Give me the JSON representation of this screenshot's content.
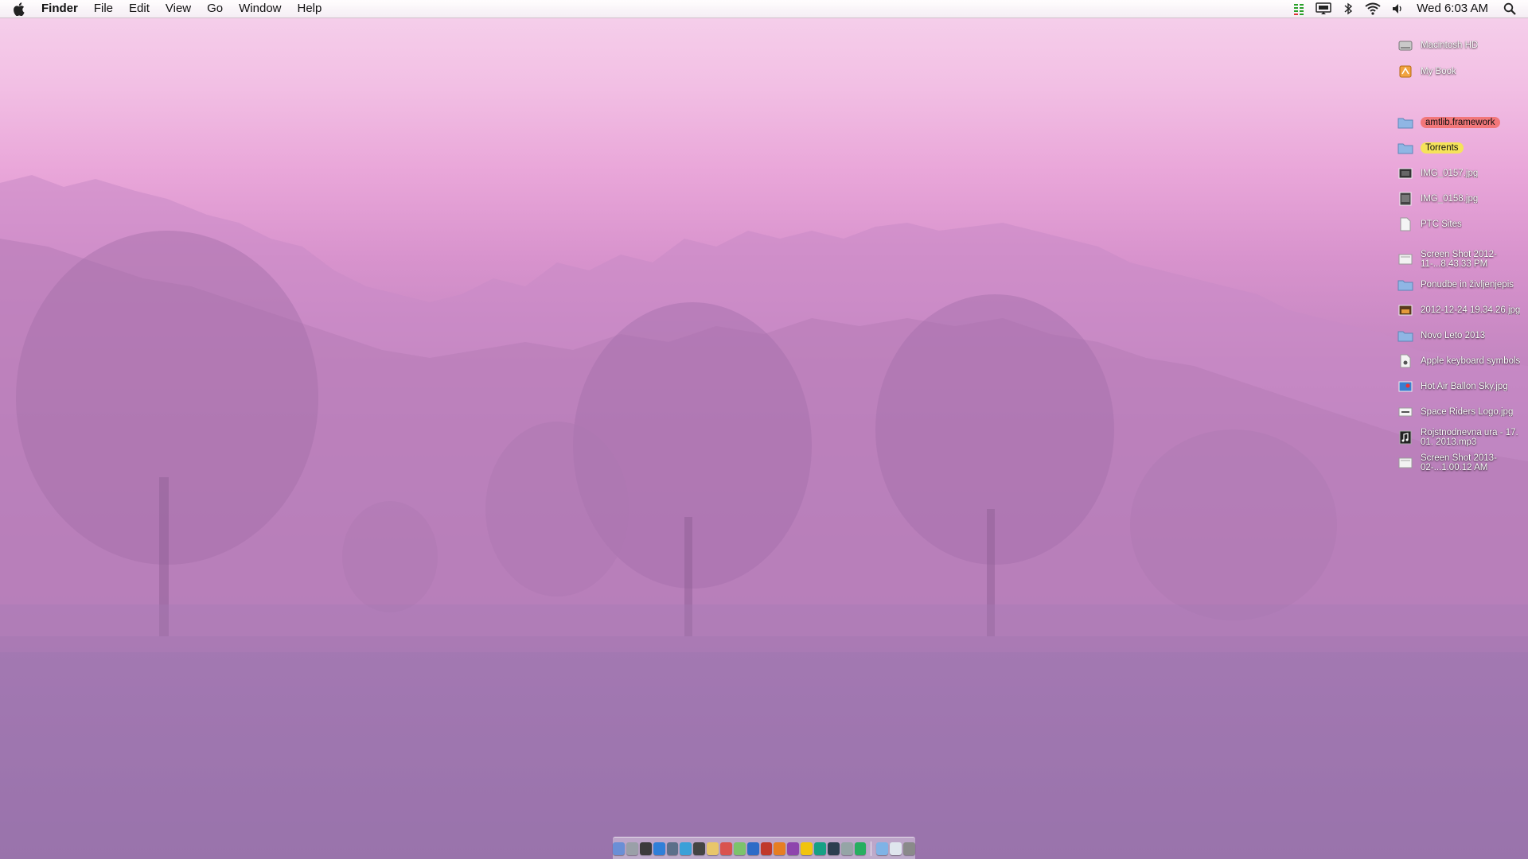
{
  "menubar": {
    "app_name": "Finder",
    "menus": [
      "File",
      "Edit",
      "View",
      "Go",
      "Window",
      "Help"
    ],
    "clock": "Wed 6:03 AM",
    "status_icons": [
      "activity-meter-icon",
      "airplay-display-icon",
      "bluetooth-icon",
      "wifi-icon",
      "volume-icon",
      "spotlight-icon"
    ]
  },
  "desktop_items": [
    {
      "label": "Macintosh HD",
      "icon": "hard-drive-icon"
    },
    {
      "label": "My Book",
      "icon": "external-drive-icon"
    },
    {
      "label": "amtlib.framework",
      "icon": "folder-icon",
      "tag_color": "#f2777a"
    },
    {
      "label": "Torrents",
      "icon": "folder-icon",
      "tag_color": "#f5e35a"
    },
    {
      "label": "IMG_0157.jpg",
      "icon": "image-thumbnail-icon"
    },
    {
      "label": "IMG_0158.jpg",
      "icon": "image-thumbnail-icon"
    },
    {
      "label": "PTC Sites",
      "icon": "document-icon"
    },
    {
      "label": "Screen Shot 2012-11-...8.43.33 PM",
      "icon": "screenshot-icon"
    },
    {
      "label": "Ponudbe in življenjepis",
      "icon": "folder-icon"
    },
    {
      "label": "2012-12-24 19.34.26.jpg",
      "icon": "image-thumbnail-icon"
    },
    {
      "label": "Novo Leto 2013",
      "icon": "folder-icon"
    },
    {
      "label": "Apple keyboard symbols",
      "icon": "document-icon"
    },
    {
      "label": "Hot Air Ballon Sky.jpg",
      "icon": "image-thumbnail-icon"
    },
    {
      "label": "Space Riders Logo.jpg",
      "icon": "image-thumbnail-icon"
    },
    {
      "label": "Rojstnodnevna ura - 17. 01. 2013.mp3",
      "icon": "music-file-icon"
    },
    {
      "label": "Screen Shot 2013-02-...1.00.12 AM",
      "icon": "screenshot-icon"
    }
  ],
  "colors": {
    "folder_blue": "#8fb6e4",
    "menubar_text": "#111111",
    "label_tag_red": "#f2777a",
    "label_tag_yellow": "#f5e35a"
  }
}
